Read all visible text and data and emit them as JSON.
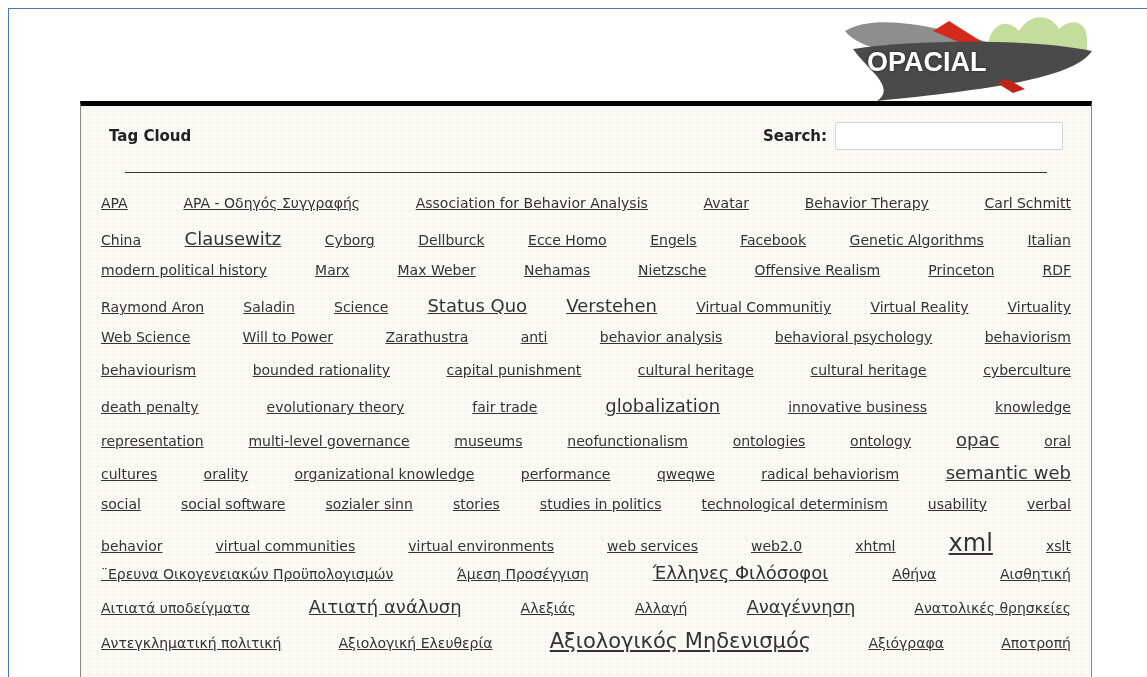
{
  "logo": {
    "text": "OPACIAL"
  },
  "panel": {
    "title": "Tag Cloud",
    "search": {
      "label": "Search:"
    }
  },
  "rows": [
    {
      "tags": [
        {
          "text": "APA",
          "kind": "normal"
        },
        {
          "text": "APA - Οδηγός Συγγραφής",
          "kind": "normal"
        },
        {
          "text": "Association for Behavior Analysis",
          "kind": "normal"
        },
        {
          "text": "Avatar",
          "kind": "normal"
        },
        {
          "text": "Behavior Therapy",
          "kind": "normal"
        },
        {
          "text": "Carl Schmitt",
          "kind": "normal"
        }
      ]
    },
    {
      "tags": [
        {
          "text": "China",
          "kind": "normal"
        },
        {
          "text": "Clausewitz",
          "kind": "large"
        },
        {
          "text": "Cyborg",
          "kind": "normal"
        },
        {
          "text": "Dellburck",
          "kind": "normal"
        },
        {
          "text": "Ecce Homo",
          "kind": "normal"
        },
        {
          "text": "Engels",
          "kind": "normal"
        },
        {
          "text": "Facebook",
          "kind": "normal"
        },
        {
          "text": "Genetic Algorithms",
          "kind": "normal"
        },
        {
          "text": "Italian",
          "kind": "normal"
        }
      ]
    },
    {
      "tags": [
        {
          "text": "modern political history",
          "kind": "normal"
        },
        {
          "text": "Marx",
          "kind": "normal"
        },
        {
          "text": "Max Weber",
          "kind": "normal"
        },
        {
          "text": "Nehamas",
          "kind": "normal"
        },
        {
          "text": "Nietzsche",
          "kind": "normal"
        },
        {
          "text": "Offensive Realism",
          "kind": "normal"
        },
        {
          "text": "Princeton",
          "kind": "normal"
        },
        {
          "text": "RDF",
          "kind": "normal"
        }
      ]
    },
    {
      "tags": [
        {
          "text": "Raymond Aron",
          "kind": "normal"
        },
        {
          "text": "Saladin",
          "kind": "normal"
        },
        {
          "text": "Science",
          "kind": "normal"
        },
        {
          "text": "Status Quo",
          "kind": "large"
        },
        {
          "text": "Verstehen",
          "kind": "large"
        },
        {
          "text": "Virtual Communitiy",
          "kind": "normal"
        },
        {
          "text": "Virtual Reality",
          "kind": "normal"
        },
        {
          "text": "Virtuality",
          "kind": "normal"
        }
      ]
    },
    {
      "tags": [
        {
          "text": "Web Science",
          "kind": "normal"
        },
        {
          "text": "Will to Power",
          "kind": "normal"
        },
        {
          "text": "Zarathustra",
          "kind": "normal"
        },
        {
          "text": "anti",
          "kind": "normal"
        },
        {
          "text": "behavior analysis",
          "kind": "normal"
        },
        {
          "text": "behavioral psychology",
          "kind": "normal"
        },
        {
          "text": "behaviorism",
          "kind": "normal"
        }
      ]
    },
    {
      "tags": [
        {
          "text": "behaviourism",
          "kind": "normal"
        },
        {
          "text": "bounded rationality",
          "kind": "normal"
        },
        {
          "text": "capital punishment",
          "kind": "normal"
        },
        {
          "text": "cultural heritage",
          "kind": "normal"
        },
        {
          "text": "cultural heritage",
          "kind": "normal"
        },
        {
          "text": "cyberculture",
          "kind": "normal"
        }
      ]
    },
    {
      "tags": [
        {
          "text": "death penalty",
          "kind": "normal"
        },
        {
          "text": "evolutionary theory",
          "kind": "normal"
        },
        {
          "text": "fair trade",
          "kind": "normal"
        },
        {
          "text": "globalization",
          "kind": "large"
        },
        {
          "text": "innovative business",
          "kind": "normal"
        },
        {
          "text": "knowledge",
          "kind": "normal"
        }
      ]
    },
    {
      "tags": [
        {
          "text": "representation",
          "kind": "normal"
        },
        {
          "text": "multi-level governance",
          "kind": "normal"
        },
        {
          "text": "museums",
          "kind": "normal"
        },
        {
          "text": "neofunctionalism",
          "kind": "normal"
        },
        {
          "text": "ontologies",
          "kind": "normal"
        },
        {
          "text": "ontology",
          "kind": "normal"
        },
        {
          "text": "opac",
          "kind": "large"
        },
        {
          "text": "oral",
          "kind": "normal"
        }
      ]
    },
    {
      "tags": [
        {
          "text": "cultures",
          "kind": "normal"
        },
        {
          "text": "orality",
          "kind": "normal"
        },
        {
          "text": "organizational knowledge",
          "kind": "normal"
        },
        {
          "text": "performance",
          "kind": "normal"
        },
        {
          "text": "qweqwe",
          "kind": "normal"
        },
        {
          "text": "radical behaviorism",
          "kind": "normal"
        },
        {
          "text": "semantic web",
          "kind": "large"
        }
      ]
    },
    {
      "tags": [
        {
          "text": "social",
          "kind": "normal"
        },
        {
          "text": "social software",
          "kind": "normal"
        },
        {
          "text": "sozialer sinn",
          "kind": "normal"
        },
        {
          "text": "stories",
          "kind": "normal"
        },
        {
          "text": "studies in politics",
          "kind": "normal"
        },
        {
          "text": "technological determinism",
          "kind": "normal"
        },
        {
          "text": "usability",
          "kind": "normal"
        },
        {
          "text": "verbal",
          "kind": "normal"
        }
      ]
    },
    {
      "tags": [
        {
          "text": "behavior",
          "kind": "normal"
        },
        {
          "text": "virtual communities",
          "kind": "normal"
        },
        {
          "text": "virtual environments",
          "kind": "normal"
        },
        {
          "text": "web services",
          "kind": "normal"
        },
        {
          "text": "web2.0",
          "kind": "normal"
        },
        {
          "text": "xhtml",
          "kind": "normal"
        },
        {
          "text": "xml",
          "kind": "largest"
        },
        {
          "text": "xslt",
          "kind": "normal"
        }
      ]
    },
    {
      "tags": [
        {
          "text": "¨Ερευνα Οικογενειακών Προϋπολογισμών",
          "kind": "normal"
        },
        {
          "text": "Άμεση Προσέγγιση",
          "kind": "normal"
        },
        {
          "text": "Έλληνες Φιλόσοφοι",
          "kind": "large"
        },
        {
          "text": "Αθήνα",
          "kind": "normal"
        },
        {
          "text": "Αισθητική",
          "kind": "normal"
        }
      ]
    },
    {
      "tags": [
        {
          "text": "Αιτιατά υποδείγματα",
          "kind": "normal"
        },
        {
          "text": "Αιτιατή ανάλυση",
          "kind": "large"
        },
        {
          "text": "Αλεξιάς",
          "kind": "normal"
        },
        {
          "text": "Αλλαγή",
          "kind": "normal"
        },
        {
          "text": "Αναγέννηση",
          "kind": "large"
        },
        {
          "text": "Ανατολικές θρησκείες",
          "kind": "normal"
        }
      ]
    },
    {
      "tags": [
        {
          "text": "Αντεγκληματική πολιτική",
          "kind": "normal"
        },
        {
          "text": "Αξιολογική Ελευθερία",
          "kind": "normal"
        },
        {
          "text": "Αξιολογικός Μηδενισμός",
          "kind": "larger"
        },
        {
          "text": "Αξιόγραφα",
          "kind": "normal"
        },
        {
          "text": "Αποτροπή",
          "kind": "normal"
        }
      ]
    }
  ]
}
